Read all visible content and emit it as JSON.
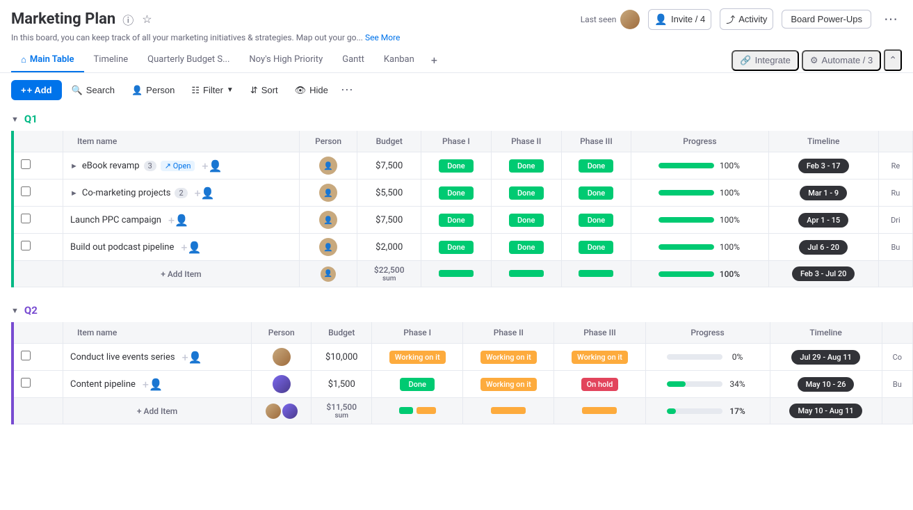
{
  "app": {
    "title": "Marketing Plan",
    "description": "In this board, you can keep track of all your marketing initiatives & strategies. Map out your go...",
    "see_more": "See More"
  },
  "header": {
    "last_seen_label": "Last seen",
    "invite_label": "Invite / 4",
    "activity_label": "Activity",
    "board_powerups_label": "Board Power-Ups"
  },
  "tabs": [
    {
      "id": "main-table",
      "label": "Main Table",
      "icon": "home-icon",
      "active": true
    },
    {
      "id": "timeline",
      "label": "Timeline",
      "active": false
    },
    {
      "id": "quarterly-budget",
      "label": "Quarterly Budget S...",
      "active": false
    },
    {
      "id": "noy-priority",
      "label": "Noy's High Priority",
      "active": false
    },
    {
      "id": "gantt",
      "label": "Gantt",
      "active": false
    },
    {
      "id": "kanban",
      "label": "Kanban",
      "active": false
    }
  ],
  "tabs_right": {
    "integrate_label": "Integrate",
    "automate_label": "Automate / 3"
  },
  "toolbar": {
    "add_label": "+ Add",
    "search_label": "Search",
    "person_label": "Person",
    "filter_label": "Filter",
    "sort_label": "Sort",
    "hide_label": "Hide"
  },
  "groups": [
    {
      "id": "q1",
      "label": "Q1",
      "color": "#00b884",
      "columns": [
        "Item name",
        "Person",
        "Budget",
        "Phase I",
        "Phase II",
        "Phase III",
        "Progress",
        "Timeline"
      ],
      "rows": [
        {
          "name": "eBook revamp",
          "count": 3,
          "open": true,
          "budget": "$7,500",
          "phase1": "Done",
          "phase2": "Done",
          "phase3": "Done",
          "progress": 100,
          "timeline": "Feb 3 - 17",
          "extra": "Re"
        },
        {
          "name": "Co-marketing projects",
          "count": 2,
          "budget": "$5,500",
          "phase1": "Done",
          "phase2": "Done",
          "phase3": "Done",
          "progress": 100,
          "timeline": "Mar 1 - 9",
          "extra": "Ru"
        },
        {
          "name": "Launch PPC campaign",
          "count": 0,
          "budget": "$7,500",
          "phase1": "Done",
          "phase2": "Done",
          "phase3": "Done",
          "progress": 100,
          "timeline": "Apr 1 - 15",
          "extra": "Dri"
        },
        {
          "name": "Build out podcast pipeline",
          "count": 0,
          "budget": "$2,000",
          "phase1": "Done",
          "phase2": "Done",
          "phase3": "Done",
          "progress": 100,
          "timeline": "Jul 6 - 20",
          "extra": "Bu"
        }
      ],
      "sum": {
        "budget": "$22,500",
        "timeline": "Feb 3 - Jul 20",
        "progress": 100
      },
      "add_item": "+ Add Item"
    },
    {
      "id": "q2",
      "label": "Q2",
      "color": "#784bd1",
      "columns": [
        "Item name",
        "Person",
        "Budget",
        "Phase I",
        "Phase II",
        "Phase III",
        "Progress",
        "Timeline"
      ],
      "rows": [
        {
          "name": "Conduct live events series",
          "count": 0,
          "budget": "$10,000",
          "phase1": "Working on it",
          "phase2": "Working on it",
          "phase3": "Working on it",
          "progress": 0,
          "timeline": "Jul 29 - Aug 11",
          "extra": "Co",
          "avatar_type": "warm"
        },
        {
          "name": "Content pipeline",
          "count": 0,
          "budget": "$1,500",
          "phase1": "Done",
          "phase2": "Working on it",
          "phase3": "On hold",
          "progress": 34,
          "timeline": "May 10 - 26",
          "extra": "Bu",
          "avatar_type": "cool"
        }
      ],
      "sum": {
        "budget": "$11,500",
        "timeline": "May 10 - Aug 11",
        "progress": 17
      },
      "add_item": "+ Add Item"
    }
  ]
}
